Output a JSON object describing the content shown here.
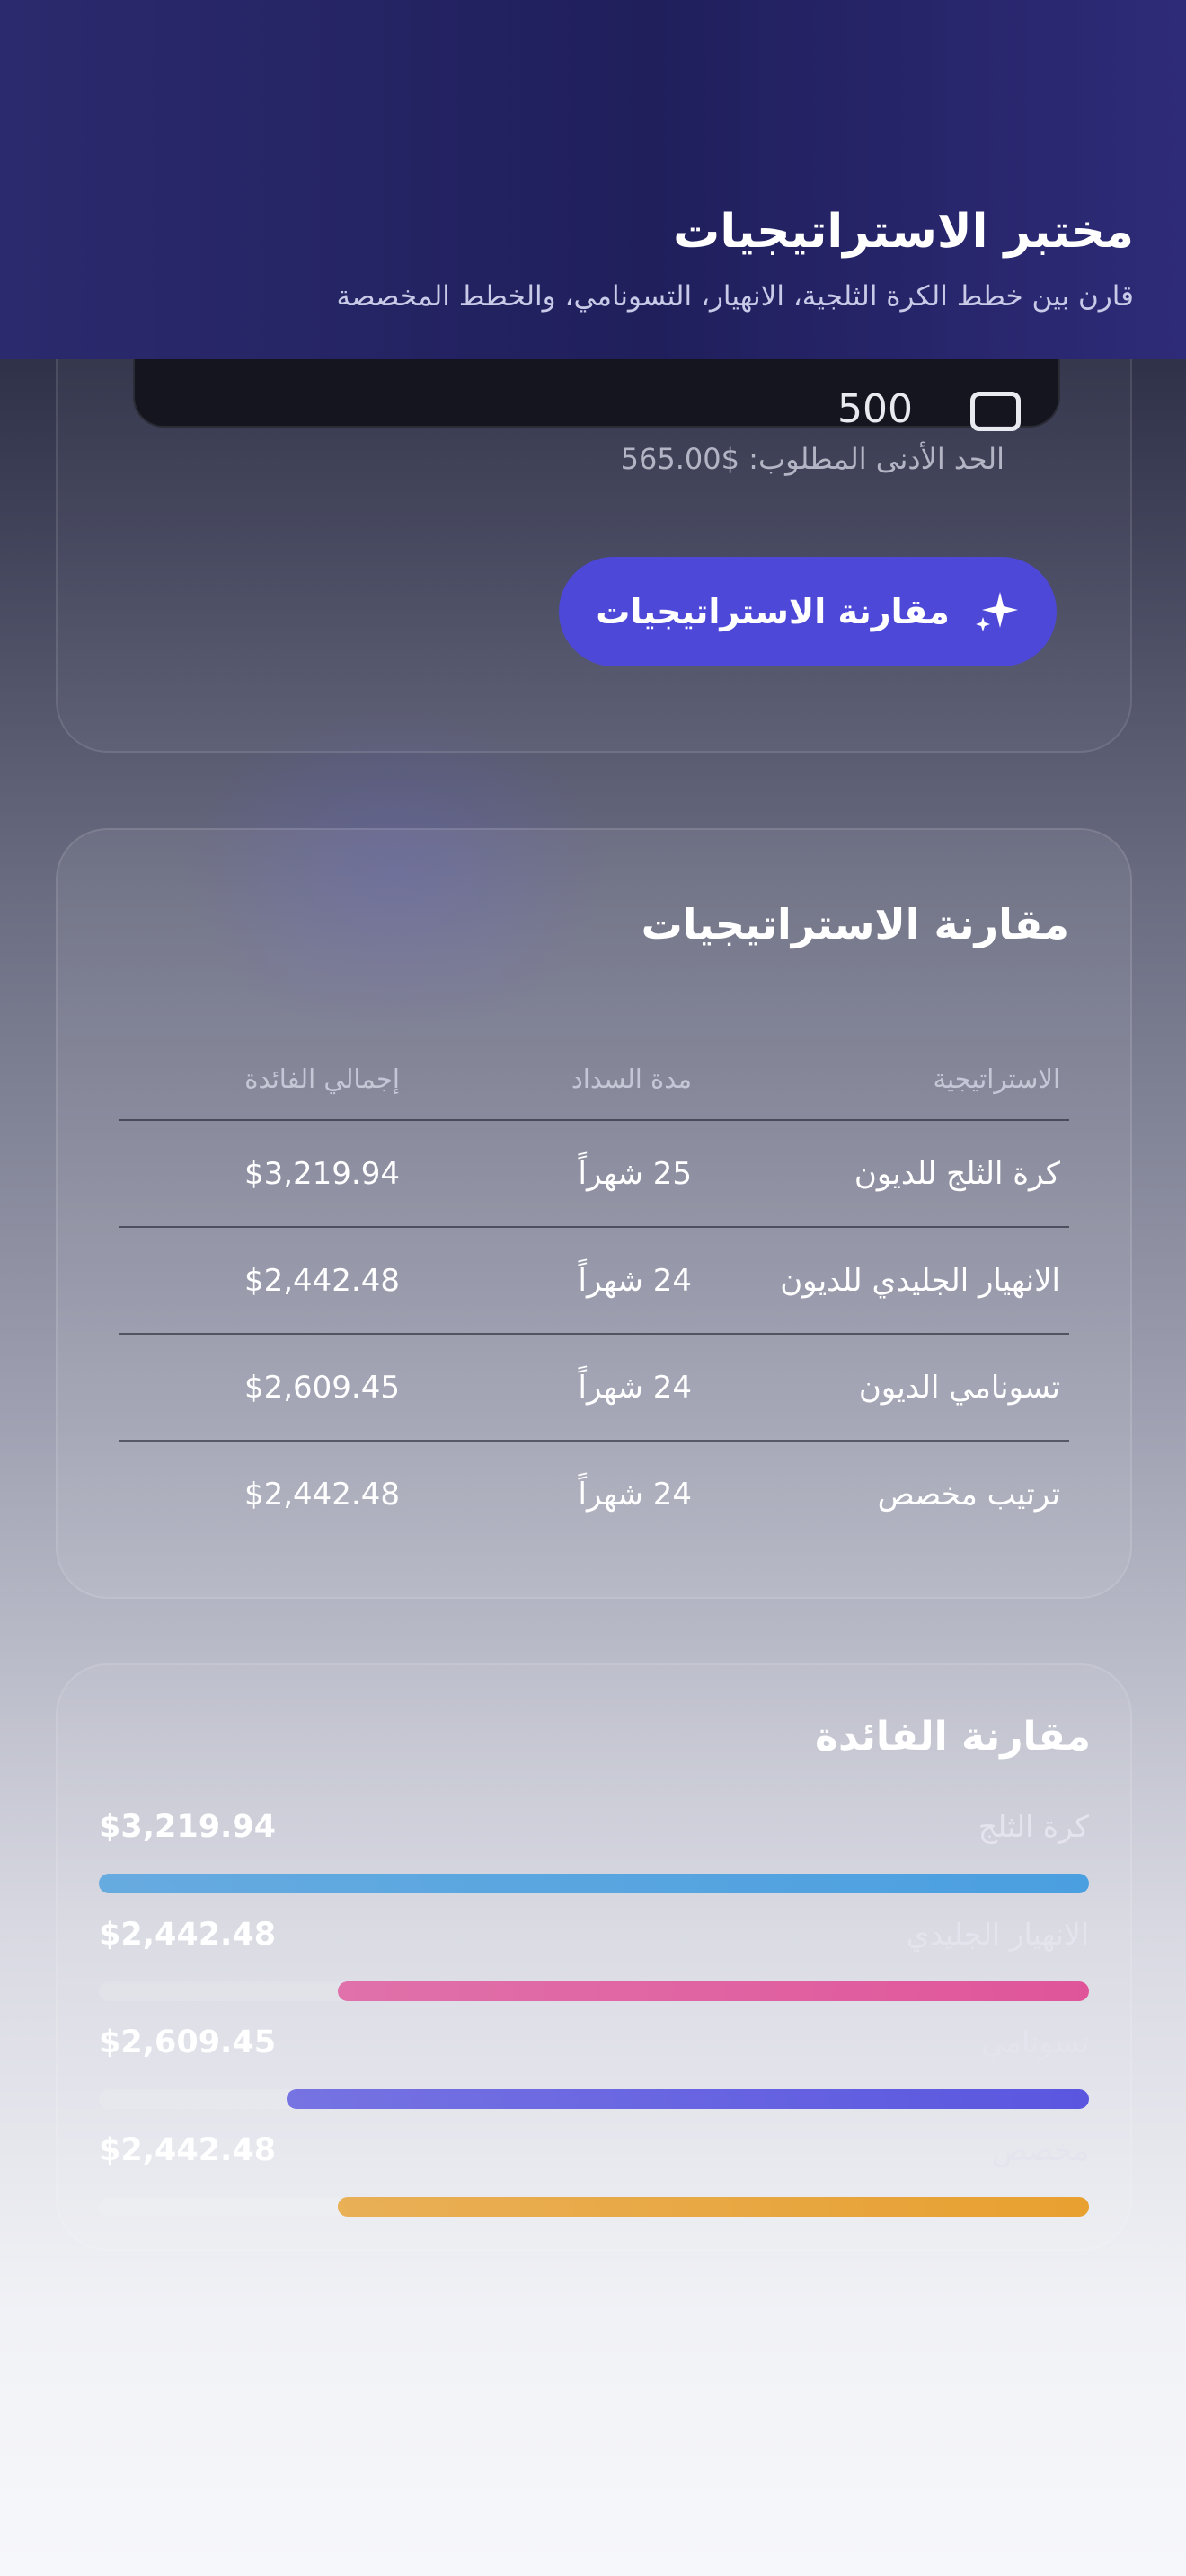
{
  "header": {
    "title": "مختبر الاستراتيجيات",
    "subtitle": "قارن بين خطط الكرة الثلجية، الانهيار، التسونامي، والخطط المخصصة"
  },
  "input_card": {
    "payment_value": "500",
    "calc_icon": "calculator-icon",
    "min_required": "الحد الأدنى المطلوب: $565.00",
    "compare_label": "مقارنة الاستراتيجيات",
    "button_icon": "sparkle-icon",
    "button_color": "#4d48d8"
  },
  "comparison_table": {
    "title": "مقارنة الاستراتيجيات",
    "columns": [
      "الاستراتيجية",
      "مدة السداد",
      "إجمالي الفائدة"
    ],
    "rows": [
      [
        "كرة الثلج للديون",
        "25 شهراً",
        "$3,219.94"
      ],
      [
        "الانهيار الجليدي للديون",
        "24 شهراً",
        "$2,442.48"
      ],
      [
        "تسونامي الديون",
        "24 شهراً",
        "$2,609.45"
      ],
      [
        "ترتيب مخصص",
        "24 شهراً",
        "$2,442.48"
      ]
    ]
  },
  "interest_comparison": {
    "title": "مقارنة الفائدة",
    "items": [
      {
        "name": "كرة الثلج",
        "value": "$3,219.94",
        "fraction": 1.0,
        "color": "#4a9fe0"
      },
      {
        "name": "الانهيار الجليدي",
        "value": "$2,442.48",
        "fraction": 0.7585,
        "color": "#e0559a"
      },
      {
        "name": "تسونامي",
        "value": "$2,609.45",
        "fraction": 0.8104,
        "color": "#5a56e0"
      },
      {
        "name": "مخصص",
        "value": "$2,442.48",
        "fraction": 0.7585,
        "color": "#e8a030"
      }
    ]
  }
}
